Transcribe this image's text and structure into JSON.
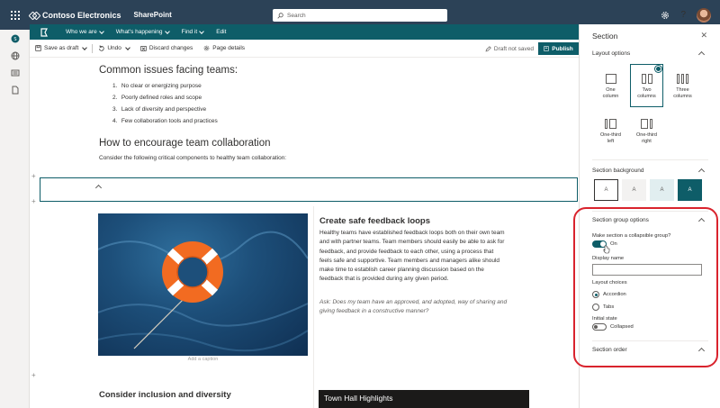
{
  "suite_bar": {
    "brand": "Contoso Electronics",
    "app": "SharePoint",
    "search_placeholder": "Search",
    "settings_icon": "gear-icon",
    "help_label": "?"
  },
  "hub_nav": {
    "items": [
      {
        "label": "Who we are"
      },
      {
        "label": "What's happening"
      },
      {
        "label": "Find it"
      },
      {
        "label": "Edit"
      }
    ]
  },
  "command_bar": {
    "save_as_draft": "Save as draft",
    "undo": "Undo",
    "discard": "Discard changes",
    "page_details": "Page details",
    "draft_status": "Draft not saved",
    "publish": "Publish"
  },
  "page": {
    "heading1": "Common issues facing teams:",
    "issues": [
      {
        "num": "1.",
        "text": "No clear or energizing purpose"
      },
      {
        "num": "2.",
        "text": "Poorly defined roles and scope"
      },
      {
        "num": "3.",
        "text": "Lack of diversity and perspective"
      },
      {
        "num": "4.",
        "text": "Few collaboration tools and practices"
      }
    ],
    "heading2": "How to encourage team collaboration",
    "intro": "Consider the following critical components to healthy team collaboration:",
    "image_caption": "Add a caption",
    "feedback_title": "Create safe feedback loops",
    "feedback_lines": [
      "Healthy teams have established feedback loops both on their own team",
      "and with partner teams. Team members should easily be able to ask for",
      "feedback, and provide feedback to each other, using a process that",
      "feels safe and supportive. Team members and managers alike should",
      "make time to establish career planning discussion based on the",
      "feedback that is provided during any given period."
    ],
    "ask_lines": [
      "Ask: Does my team have an approved, and adopted, way of sharing and",
      "giving feedback in a constructive manner?"
    ],
    "heading3": "Consider inclusion and diversity",
    "town_hall": "Town Hall Highlights"
  },
  "panel": {
    "title": "Section",
    "layout_options_title": "Layout options",
    "layouts": [
      {
        "line1": "One",
        "line2": "column"
      },
      {
        "line1": "Two",
        "line2": "columns"
      },
      {
        "line1": "Three",
        "line2": "columns"
      },
      {
        "line1": "One-third",
        "line2": "left"
      },
      {
        "line1": "One-third",
        "line2": "right"
      }
    ],
    "selected_layout": "Two columns",
    "background_title": "Section background",
    "background_swatch_glyph": "A",
    "group_options_title": "Section group options",
    "collapsible_label": "Make section a collapsible group?",
    "collapsible_state": "On",
    "display_name_label": "Display name",
    "display_name_value": "",
    "layout_choices_label": "Layout choices",
    "choice_accordion": "Accordion",
    "choice_tabs": "Tabs",
    "initial_state_label": "Initial state",
    "initial_state_value": "Collapsed",
    "section_order_title": "Section order"
  },
  "colors": {
    "suite_bar": "#2c4257",
    "hub_nav": "#0e5d68",
    "accent": "#0e5d68",
    "highlight": "#d9232d"
  }
}
